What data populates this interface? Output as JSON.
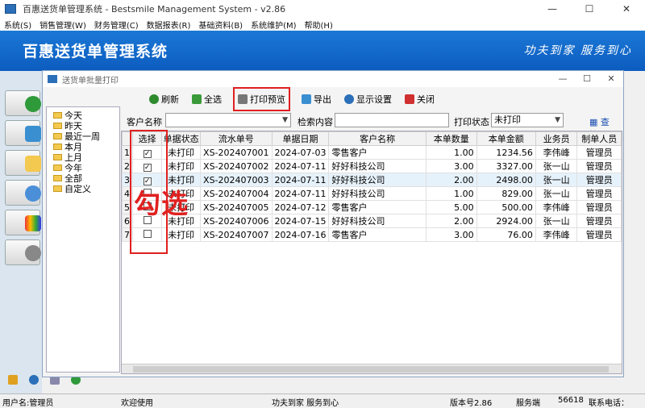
{
  "window": {
    "title": "百惠送货单管理系统 - Bestsmile Management System - v2.86",
    "min": "—",
    "max": "☐",
    "close": "✕"
  },
  "menu": [
    "系统(S)",
    "销售管理(W)",
    "财务管理(C)",
    "数据报表(R)",
    "基础资料(B)",
    "系统维护(M)",
    "帮助(H)"
  ],
  "banner": {
    "title": "百惠送货单管理系统",
    "slogan": "功夫到家 服务到心"
  },
  "dialog": {
    "title": "送货单批量打印",
    "min": "—",
    "max": "☐",
    "close": "✕",
    "toolbar": [
      {
        "label": "刷新",
        "icon": "refresh-icon",
        "color": "#2e8b2e"
      },
      {
        "label": "全选",
        "icon": "select-all-icon",
        "color": "#3a9a3a"
      },
      {
        "label": "打印预览",
        "icon": "printer-icon",
        "color": "#777777"
      },
      {
        "label": "导出",
        "icon": "export-icon",
        "color": "#3a8fd1"
      },
      {
        "label": "显示设置",
        "icon": "settings-icon",
        "color": "#2a6fb8"
      },
      {
        "label": "关闭",
        "icon": "close-icon",
        "color": "#d03030"
      }
    ],
    "tree": [
      "今天",
      "昨天",
      "最近一周",
      "本月",
      "上月",
      "今年",
      "全部",
      "自定义"
    ],
    "filter": {
      "customer_label": "客户名称",
      "customer_value": "",
      "search_label": "检索内容",
      "search_value": "",
      "status_label": "打印状态",
      "status_value": "未打印",
      "find_label": "查找.."
    },
    "columns": [
      "选择",
      "单据状态",
      "流水单号",
      "单据日期",
      "客户名称",
      "本单数量",
      "本单金额",
      "业务员",
      "制单人员"
    ],
    "rows": [
      {
        "n": "1",
        "checked": true,
        "status": "未打印",
        "no": "XS-202407001",
        "date": "2024-07-03",
        "customer": "零售客户",
        "qty": "1.00",
        "amount": "1234.56",
        "sales": "李伟峰",
        "maker": "管理员"
      },
      {
        "n": "2",
        "checked": true,
        "status": "未打印",
        "no": "XS-202407002",
        "date": "2024-07-11",
        "customer": "好好科技公司",
        "qty": "3.00",
        "amount": "3327.00",
        "sales": "张一山",
        "maker": "管理员"
      },
      {
        "n": "3",
        "checked": true,
        "status": "未打印",
        "no": "XS-202407003",
        "date": "2024-07-11",
        "customer": "好好科技公司",
        "qty": "2.00",
        "amount": "2498.00",
        "sales": "张一山",
        "maker": "管理员"
      },
      {
        "n": "4",
        "checked": false,
        "status": "未打印",
        "no": "XS-202407004",
        "date": "2024-07-11",
        "customer": "好好科技公司",
        "qty": "1.00",
        "amount": "829.00",
        "sales": "张一山",
        "maker": "管理员"
      },
      {
        "n": "5",
        "checked": false,
        "status": "未打印",
        "no": "XS-202407005",
        "date": "2024-07-12",
        "customer": "零售客户",
        "qty": "5.00",
        "amount": "500.00",
        "sales": "李伟峰",
        "maker": "管理员"
      },
      {
        "n": "6",
        "checked": false,
        "status": "未打印",
        "no": "XS-202407006",
        "date": "2024-07-15",
        "customer": "好好科技公司",
        "qty": "2.00",
        "amount": "2924.00",
        "sales": "张一山",
        "maker": "管理员"
      },
      {
        "n": "7",
        "checked": false,
        "status": "未打印",
        "no": "XS-202407007",
        "date": "2024-07-16",
        "customer": "零售客户",
        "qty": "3.00",
        "amount": "76.00",
        "sales": "李伟峰",
        "maker": "管理员"
      }
    ],
    "annotation": "勾选"
  },
  "status": {
    "user": "用户名:管理员",
    "welcome": "欢迎使用",
    "slogan": "功夫到家 服务到心",
    "version": "版本号2.86",
    "server_label": "服务端",
    "server_port": "56618",
    "contact": "联系电话："
  }
}
